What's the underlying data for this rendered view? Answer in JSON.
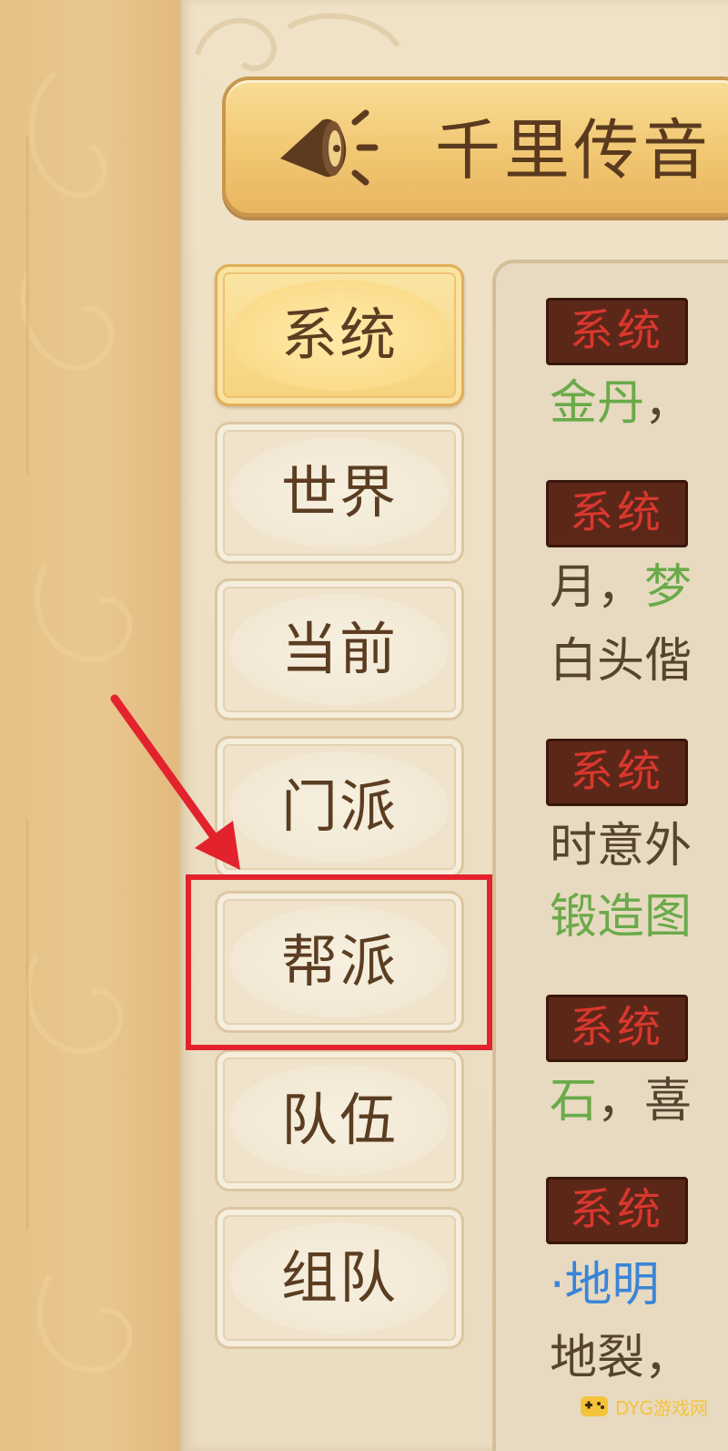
{
  "title": {
    "text": "千里传音",
    "icon": "horn-icon"
  },
  "tabs": [
    {
      "label": "系统",
      "active": true
    },
    {
      "label": "世界",
      "active": false
    },
    {
      "label": "当前",
      "active": false
    },
    {
      "label": "门派",
      "active": false
    },
    {
      "label": "帮派",
      "active": false,
      "highlighted": true
    },
    {
      "label": "队伍",
      "active": false
    },
    {
      "label": "组队",
      "active": false
    }
  ],
  "messages": [
    {
      "tag": "系统",
      "lines": [
        [
          {
            "text": "金丹",
            "color": "green"
          },
          {
            "text": "，",
            "color": "normal"
          }
        ]
      ]
    },
    {
      "tag": "系统",
      "lines": [
        [
          {
            "text": "月，",
            "color": "normal"
          },
          {
            "text": "梦",
            "color": "green"
          }
        ],
        [
          {
            "text": "白头偕",
            "color": "normal"
          }
        ]
      ]
    },
    {
      "tag": "系统",
      "lines": [
        [
          {
            "text": "时意外",
            "color": "normal"
          }
        ],
        [
          {
            "text": "锻造图",
            "color": "green"
          }
        ]
      ]
    },
    {
      "tag": "系统",
      "lines": [
        [
          {
            "text": "石",
            "color": "green"
          },
          {
            "text": "，喜",
            "color": "normal"
          }
        ]
      ]
    },
    {
      "tag": "系统",
      "lines": [
        [
          {
            "text": "·地明",
            "color": "blue"
          }
        ],
        [
          {
            "text": "地裂，",
            "color": "normal"
          }
        ]
      ]
    }
  ],
  "watermark": {
    "text": "DYG游戏网",
    "logo": "game-controller-logo"
  },
  "colors": {
    "badge_bg": "#5b2718",
    "badge_text": "#d9372e",
    "highlight": "#e2232e",
    "green_text": "#6aaa4a",
    "blue_text": "#3a85d8",
    "normal_text": "#55442f"
  }
}
